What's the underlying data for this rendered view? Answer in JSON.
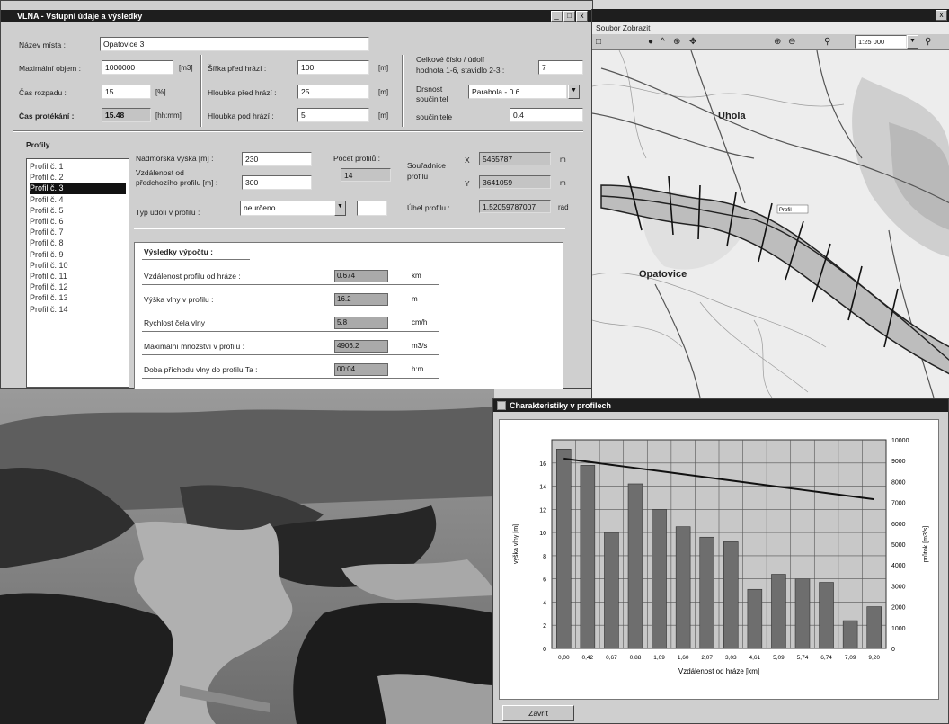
{
  "main_window": {
    "title": "VLNA - Vstupní údaje a výsledky",
    "controls": [
      "_",
      "□",
      "x"
    ],
    "place_label": "Název místa :",
    "place_value": "Opatovice 3",
    "max_volume_label": "Maximální objem :",
    "max_volume_value": "1000000",
    "max_volume_unit": "[m3]",
    "breach_time_label": "Čas rozpadu :",
    "breach_time_value": "15",
    "breach_time_unit": "[%]",
    "flow_time_label": "Čas protékání :",
    "flow_time_value": "15.48",
    "flow_time_unit": "[hh:mm]",
    "dam_width_label": "Šířka před hrází :",
    "dam_width_value": "100",
    "dam_width_unit": "[m]",
    "depth_before_label": "Hloubka před hrází :",
    "depth_before_value": "25",
    "depth_before_unit": "[m]",
    "depth_after_label": "Hloubka pod hrází :",
    "depth_after_value": "5",
    "depth_after_unit": "[m]",
    "right_label_1": "Celkové číslo / údolí",
    "right_label_2": "hodnota 1-6, stavidlo 2-3 :",
    "right_value_1": "7",
    "roughness_label_1": "Drsnost",
    "roughness_label_2": "součinitel",
    "roughness_value": "Parabola - 0.6",
    "coef_label": "součinitele",
    "coef_value": "0.4",
    "profiles_heading": "Profily",
    "profiles": [
      "Profil č. 1",
      "Profil č. 2",
      "Profil č. 3",
      "Profil č. 4",
      "Profil č. 5",
      "Profil č. 6",
      "Profil č. 7",
      "Profil č. 8",
      "Profil č. 9",
      "Profil č. 10",
      "Profil č. 11",
      "Profil č. 12",
      "Profil č. 13",
      "Profil č. 14"
    ],
    "selected_profile": "Profil č. 3",
    "alt_label": "Nadmořská výška [m] :",
    "alt_value": "230",
    "dist_label_1": "Vzdálenost od",
    "dist_label_2": "předchozího profilu [m] :",
    "dist_value": "300",
    "count_label": "Počet profilů :",
    "count_value": "14",
    "coords_label": "Souřadnice",
    "coords_label_2": "profilu",
    "x_label": "X",
    "x_value": "5465787",
    "y_label": "Y",
    "y_value": "3641059",
    "x_unit": "m",
    "y_unit": "m",
    "angle_label": "Úhel profilu :",
    "angle_value": "1.52059787007",
    "angle_unit": "rad",
    "type_label": "Typ údolí v profilu :",
    "type_value": "neurčeno",
    "results_heading": "Výsledky výpočtu :",
    "results": [
      {
        "label": "Vzdálenost profilu od hráze :",
        "value": "0.674",
        "unit": "km"
      },
      {
        "label": "Výška vlny v profilu :",
        "value": "16.2",
        "unit": "m"
      },
      {
        "label": "Rychlost čela vlny :",
        "value": "5.8",
        "unit": "cm/h"
      },
      {
        "label": "Maximální množství v profilu :",
        "value": "4906.2",
        "unit": "m3/s"
      },
      {
        "label": "Doba příchodu vlny do profilu Ta :",
        "value": "00:04",
        "unit": "h:m"
      }
    ]
  },
  "map_window": {
    "menu": "Soubor  Zobrazit",
    "zoom_value": "1:25 000",
    "labels": [
      "Uhola",
      "Opatovice",
      "Profil"
    ]
  },
  "graph_window": {
    "title": "Charakteristiky v profilech",
    "close_label": "Zavřít",
    "xlabel": "Vzdálenost od hráze [km]",
    "ylabel_left": "výška vlny [m]",
    "ylabel_right": "průtok [m3/s]"
  },
  "chart_data": {
    "type": "bar",
    "categories": [
      "0,00",
      "0,42",
      "0,67",
      "0,88",
      "1,09",
      "1,60",
      "2,07",
      "3,03",
      "4,61",
      "5,09",
      "5,74",
      "6,74",
      "7,09",
      "9,20"
    ],
    "series": [
      {
        "values": [
          17.2,
          15.8,
          10.0,
          14.2,
          12.0,
          10.5,
          9.6,
          9.2,
          5.1,
          6.4,
          6.0,
          5.7,
          2.4,
          3.6
        ]
      },
      {
        "values": [
          9100,
          8950,
          8800,
          8650,
          8500,
          8350,
          8200,
          8050,
          7900,
          7750,
          7600,
          7450,
          7300,
          7150
        ]
      }
    ],
    "ylim": [
      0,
      18
    ],
    "yticks": [
      "0",
      "2",
      "4",
      "6",
      "8",
      "10",
      "12",
      "14",
      "16"
    ],
    "y2lim": [
      0,
      10000
    ],
    "y2ticks": [
      "0",
      "1000",
      "2000",
      "3000",
      "4000",
      "5000",
      "6000",
      "7000",
      "8000",
      "9000",
      "10000"
    ],
    "grid": true
  }
}
